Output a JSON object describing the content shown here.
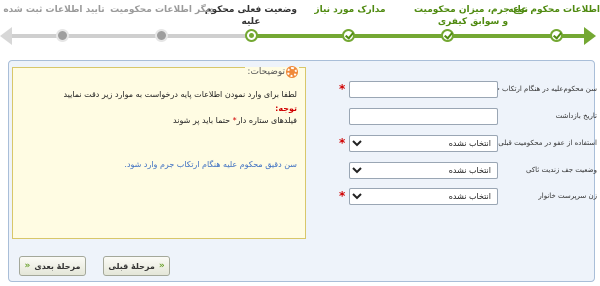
{
  "wizard": {
    "steps": [
      {
        "label": "اطلاعات محکوم علیه",
        "state": "done"
      },
      {
        "label": "نوع جرم، میزان محکومیت و سوابق کیفری",
        "state": "done"
      },
      {
        "label": "مدارک مورد نیاز",
        "state": "done"
      },
      {
        "label": "وضعیت فعلی محکوم علیه",
        "state": "current"
      },
      {
        "label": "دیگر اطلاعات محکومیت",
        "state": "todo"
      },
      {
        "label": "تایید اطلاعات ثبت شده",
        "state": "todo"
      }
    ],
    "step2_line1": "نوع جرم، میزان محکومیت",
    "step2_line2": "و سوابق کیفری",
    "step4_line1": "وضعیت فعلی محکوم",
    "step4_line2": "علیه"
  },
  "description": {
    "title": "توضیحات:",
    "line1": "لطفا برای وارد نمودن اطلاعات پایه درخواست به موارد زیر دقت نمایید",
    "line2": "توجه:",
    "line3_a": "فیلدهای ستاره دار",
    "line3_star": "*",
    "line3_b": " حتما باید پر شوند",
    "line4": "سن دقیق محکوم علیه هنگام ارتکاب جرم وارد شود."
  },
  "form": {
    "fields": [
      {
        "label": "سن محکوم‌علیه در هنگام ارتکاب جرم",
        "value": "",
        "required": true,
        "type": "text"
      },
      {
        "label": "تاریخ بازداشت",
        "value": "",
        "required": false,
        "type": "text"
      },
      {
        "label": "استفاده از عفو در محکومیت قبلی",
        "value": "انتخاب نشده",
        "required": true,
        "type": "select"
      },
      {
        "label": "وضعیت جف زندیت ثاکی",
        "value": "انتخاب نشده",
        "required": false,
        "type": "select"
      },
      {
        "label": "زن سرپرست خانوار",
        "value": "انتخاب نشده",
        "required": true,
        "type": "select"
      }
    ]
  },
  "buttons": {
    "prev_label": "مرحلهٔ قبلی",
    "next_label": "مرحلهٔ بعدی",
    "prev_chevron": "«",
    "next_chevron": "«"
  },
  "colors": {
    "accent_green": "#74a833",
    "required_red": "#d00000",
    "panel_bg": "#eef3fa",
    "note_bg": "#fffce3"
  },
  "icons": {
    "description_icon": "gear-icon",
    "done_node": "check-icon"
  }
}
